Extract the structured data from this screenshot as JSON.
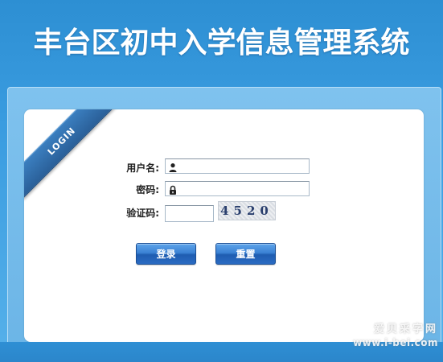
{
  "page": {
    "title": "丰台区初中入学信息管理系统"
  },
  "login_ribbon": {
    "label": "LOGIN"
  },
  "form": {
    "username_label": "用户名:",
    "username_value": "",
    "password_label": "密码:",
    "password_value": "",
    "captcha_label": "验证码:",
    "captcha_value": "",
    "captcha_image_text": "4520"
  },
  "buttons": {
    "login_label": "登录",
    "reset_label": "重置"
  },
  "watermark": {
    "line1": "爱贝采字网",
    "line2": "www.i-bei.com"
  },
  "colors": {
    "background": "#3a9ce0",
    "card": "#ffffff",
    "button": "#2a6bc2",
    "ribbon": "#2a5f98"
  },
  "icons": {
    "username": "user-icon",
    "password": "lock-icon"
  }
}
